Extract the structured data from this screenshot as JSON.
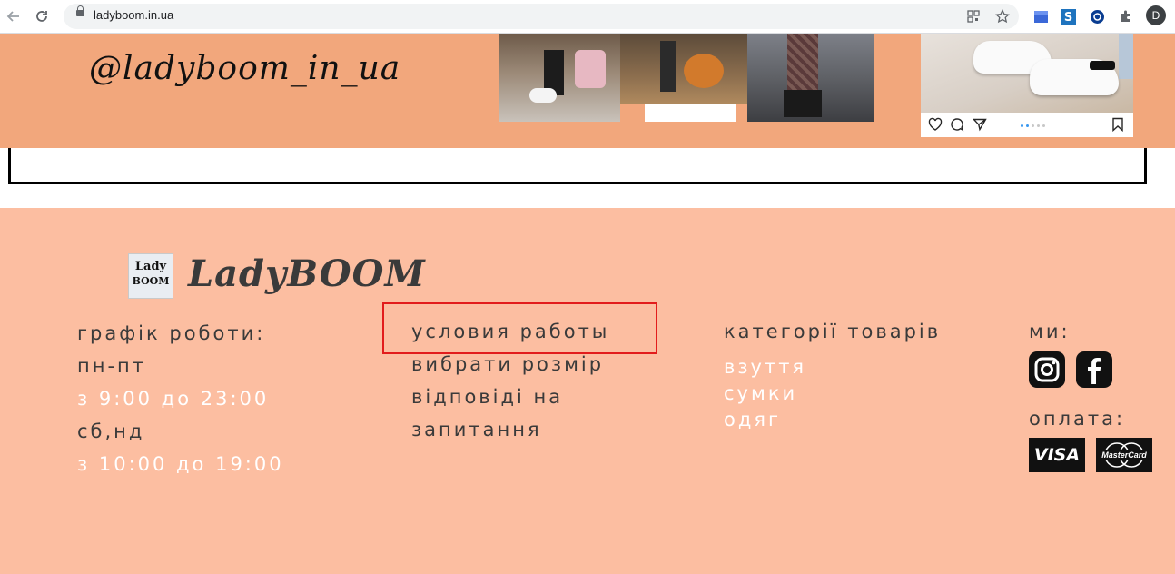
{
  "browser": {
    "url": "ladyboom.in.ua",
    "profile_initial": "D"
  },
  "instagram": {
    "handle": "@ladyboom_in_ua"
  },
  "footer": {
    "logo": {
      "line1": "Lady",
      "line2": "BOOM"
    },
    "brand": "LadyBOOM",
    "schedule": {
      "title": "графік роботи:",
      "weekdays_label": "пн-пт",
      "weekdays_hours": "з 9:00 до 23:00",
      "weekend_label": "сб,нд",
      "weekend_hours": "з 10:00 до 19:00"
    },
    "info_links": [
      {
        "label": "условия работы"
      },
      {
        "label": "вибрати розмір"
      },
      {
        "label": "відповіді на"
      },
      {
        "label": "запитання"
      }
    ],
    "categories": {
      "title": "категорії товарів",
      "items": [
        {
          "label": "взуття"
        },
        {
          "label": "сумки"
        },
        {
          "label": "одяг"
        }
      ]
    },
    "social_title": "ми:",
    "payment_title": "оплата:",
    "payment_methods": [
      {
        "label": "VISA"
      },
      {
        "label": "MasterCard"
      }
    ]
  },
  "colors": {
    "insta_band": "#f2a77c",
    "footer_bg": "#fcbea1",
    "highlight": "#e21c1c",
    "footer_dark_text": "#3a3a3a",
    "footer_light_text": "#ffffff"
  }
}
